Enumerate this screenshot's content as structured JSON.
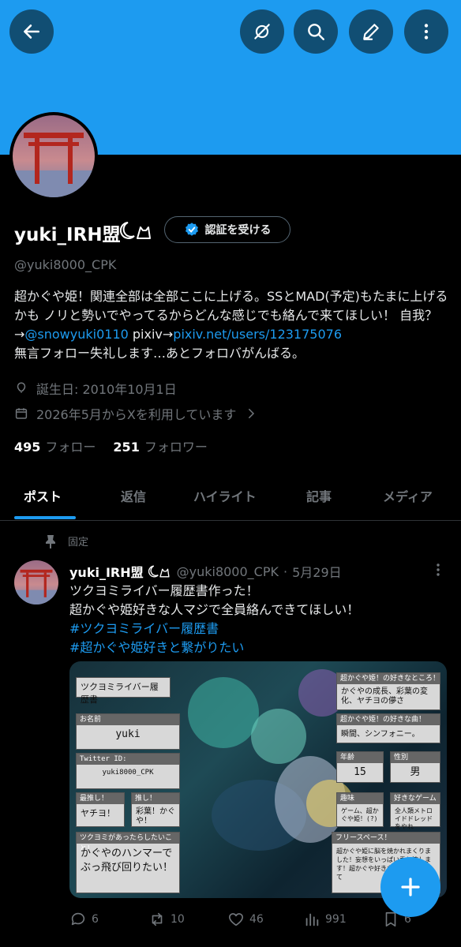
{
  "header": {
    "back": "back-arrow-icon",
    "actions": [
      "eye-off-icon",
      "search-icon",
      "edit-icon",
      "more-vertical-icon"
    ]
  },
  "profile": {
    "name": "yuki_IRH盟",
    "verify_label": "認証を受ける",
    "handle": "@yuki8000_CPK",
    "bio_1": "超かぐや姫！関連全部は全部ここに上げる。SSとMAD(予定)もたまに上げるかも ノリと勢いでやってるからどんな感じでも絡んで来てほしい！ 自我？→",
    "bio_link_1": "@snowyuki0110",
    "bio_2": " pixiv→",
    "bio_link_2": "pixiv.net/users/123175076",
    "bio_3": "無言フォロー失礼します…あとフォロバがんばる。",
    "birthday": "誕生日: 2010年10月1日",
    "joined": "2026年5月からXを利用しています",
    "following_count": "495",
    "following_label": "フォロー",
    "followers_count": "251",
    "followers_label": "フォロワー"
  },
  "tabs": [
    "ポスト",
    "返信",
    "ハイライト",
    "記事",
    "メディア"
  ],
  "post": {
    "pinned_label": "固定",
    "author": "yuki_IRH盟",
    "handle": "@yuki8000_CPK",
    "separator": "·",
    "date": "5月29日",
    "line1": "ツクヨミライバー履歴書作った！",
    "line2": "超かぐや姫好きな人マジで全員絡んできてほしい！",
    "hashtag1": "#ツクヨミライバー履歴書",
    "hashtag2": "#超かぐや姫好きと繋がりたい",
    "replies": "6",
    "reposts": "10",
    "likes": "46",
    "views": "991",
    "bookmarks": "6"
  },
  "media_card": {
    "title": "ツクヨミライバー履歴書",
    "name_label": "お名前",
    "name_value": "yuki",
    "twitter_label": "Twitter ID:",
    "twitter_value": "yuki8000_CPK",
    "oshi_label": "最推し！",
    "oshi_value": "ヤチヨ！",
    "oshi2_label": "推し！",
    "oshi2_value": "彩葉！かぐや！",
    "wish_label": "ツクヨミがあったらしたいこと！",
    "wish_value": "かぐやのハンマーでぶっ飛び回りたい！",
    "fav_point_label": "超かぐや姫！の好きなところ！",
    "fav_point_value": "かぐやの成長、彩葉の変化、ヤチヨの儚さ",
    "fav_song_label": "超かぐや姫！の好きな曲！",
    "fav_song_value": "瞬間、シンフォニー。",
    "age_label": "年齢",
    "age_value": "15",
    "gender_label": "性別",
    "gender_value": "男",
    "hobby_label": "趣味",
    "hobby_value": "ゲーム、超かぐや姫！(?)",
    "game_label": "好きなゲーム",
    "game_value": "全人類メトロイドドレッドをやれ",
    "free_label": "フリースペース！",
    "free_value": "超かぐや姫に脳を焼かれまくりました！妄想をいっぱい垂れ流します！超かぐや好きな人は絡んで来て"
  },
  "colors": {
    "accent": "#1d9bf0",
    "banner": "#1d9bf0",
    "muted": "#71767b"
  }
}
